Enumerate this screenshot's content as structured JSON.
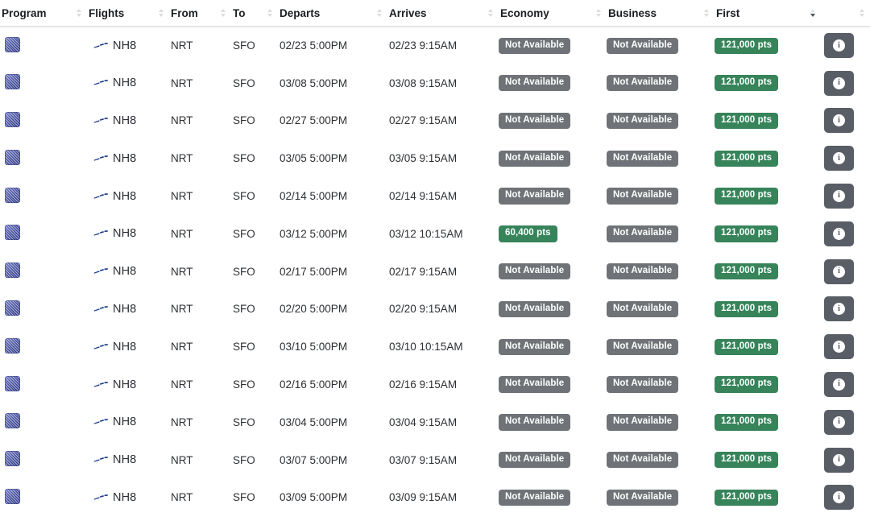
{
  "table": {
    "columns": [
      {
        "key": "program",
        "label": "Program",
        "sortable": true,
        "sort_state": "none"
      },
      {
        "key": "flights",
        "label": "Flights",
        "sortable": true,
        "sort_state": "none"
      },
      {
        "key": "from",
        "label": "From",
        "sortable": true,
        "sort_state": "none"
      },
      {
        "key": "to",
        "label": "To",
        "sortable": true,
        "sort_state": "none"
      },
      {
        "key": "departs",
        "label": "Departs",
        "sortable": true,
        "sort_state": "none"
      },
      {
        "key": "arrives",
        "label": "Arrives",
        "sortable": true,
        "sort_state": "none"
      },
      {
        "key": "economy",
        "label": "Economy",
        "sortable": true,
        "sort_state": "none"
      },
      {
        "key": "business",
        "label": "Business",
        "sortable": true,
        "sort_state": "none"
      },
      {
        "key": "first",
        "label": "First",
        "sortable": true,
        "sort_state": "desc"
      },
      {
        "key": "actions",
        "label": "",
        "sortable": true,
        "sort_state": "none"
      }
    ],
    "not_available_label": "Not Available",
    "info_icon": "info-icon",
    "program_icon": "ana-program-logo-icon",
    "airline_icon": "ana-airline-logo-icon",
    "rows": [
      {
        "flight": "NH8",
        "from": "NRT",
        "to": "SFO",
        "departs": "02/23 5:00PM",
        "arrives": "02/23 9:15AM",
        "economy": "Not Available",
        "economy_available": false,
        "business": "Not Available",
        "business_available": false,
        "first": "121,000 pts",
        "first_available": true
      },
      {
        "flight": "NH8",
        "from": "NRT",
        "to": "SFO",
        "departs": "03/08 5:00PM",
        "arrives": "03/08 9:15AM",
        "economy": "Not Available",
        "economy_available": false,
        "business": "Not Available",
        "business_available": false,
        "first": "121,000 pts",
        "first_available": true
      },
      {
        "flight": "NH8",
        "from": "NRT",
        "to": "SFO",
        "departs": "02/27 5:00PM",
        "arrives": "02/27 9:15AM",
        "economy": "Not Available",
        "economy_available": false,
        "business": "Not Available",
        "business_available": false,
        "first": "121,000 pts",
        "first_available": true
      },
      {
        "flight": "NH8",
        "from": "NRT",
        "to": "SFO",
        "departs": "03/05 5:00PM",
        "arrives": "03/05 9:15AM",
        "economy": "Not Available",
        "economy_available": false,
        "business": "Not Available",
        "business_available": false,
        "first": "121,000 pts",
        "first_available": true
      },
      {
        "flight": "NH8",
        "from": "NRT",
        "to": "SFO",
        "departs": "02/14 5:00PM",
        "arrives": "02/14 9:15AM",
        "economy": "Not Available",
        "economy_available": false,
        "business": "Not Available",
        "business_available": false,
        "first": "121,000 pts",
        "first_available": true
      },
      {
        "flight": "NH8",
        "from": "NRT",
        "to": "SFO",
        "departs": "03/12 5:00PM",
        "arrives": "03/12 10:15AM",
        "economy": "60,400 pts",
        "economy_available": true,
        "business": "Not Available",
        "business_available": false,
        "first": "121,000 pts",
        "first_available": true
      },
      {
        "flight": "NH8",
        "from": "NRT",
        "to": "SFO",
        "departs": "02/17 5:00PM",
        "arrives": "02/17 9:15AM",
        "economy": "Not Available",
        "economy_available": false,
        "business": "Not Available",
        "business_available": false,
        "first": "121,000 pts",
        "first_available": true
      },
      {
        "flight": "NH8",
        "from": "NRT",
        "to": "SFO",
        "departs": "02/20 5:00PM",
        "arrives": "02/20 9:15AM",
        "economy": "Not Available",
        "economy_available": false,
        "business": "Not Available",
        "business_available": false,
        "first": "121,000 pts",
        "first_available": true
      },
      {
        "flight": "NH8",
        "from": "NRT",
        "to": "SFO",
        "departs": "03/10 5:00PM",
        "arrives": "03/10 10:15AM",
        "economy": "Not Available",
        "economy_available": false,
        "business": "Not Available",
        "business_available": false,
        "first": "121,000 pts",
        "first_available": true
      },
      {
        "flight": "NH8",
        "from": "NRT",
        "to": "SFO",
        "departs": "02/16 5:00PM",
        "arrives": "02/16 9:15AM",
        "economy": "Not Available",
        "economy_available": false,
        "business": "Not Available",
        "business_available": false,
        "first": "121,000 pts",
        "first_available": true
      },
      {
        "flight": "NH8",
        "from": "NRT",
        "to": "SFO",
        "departs": "03/04 5:00PM",
        "arrives": "03/04 9:15AM",
        "economy": "Not Available",
        "economy_available": false,
        "business": "Not Available",
        "business_available": false,
        "first": "121,000 pts",
        "first_available": true
      },
      {
        "flight": "NH8",
        "from": "NRT",
        "to": "SFO",
        "departs": "03/07 5:00PM",
        "arrives": "03/07 9:15AM",
        "economy": "Not Available",
        "economy_available": false,
        "business": "Not Available",
        "business_available": false,
        "first": "121,000 pts",
        "first_available": true
      },
      {
        "flight": "NH8",
        "from": "NRT",
        "to": "SFO",
        "departs": "03/09 5:00PM",
        "arrives": "03/09 9:15AM",
        "economy": "Not Available",
        "economy_available": false,
        "business": "Not Available",
        "business_available": false,
        "first": "121,000 pts",
        "first_available": true
      }
    ]
  },
  "colors": {
    "badge_available": "#37835a",
    "badge_unavailable": "#6f7377",
    "info_button": "#595e66",
    "header_text": "#1a1d21",
    "row_text": "#2c2f33"
  }
}
